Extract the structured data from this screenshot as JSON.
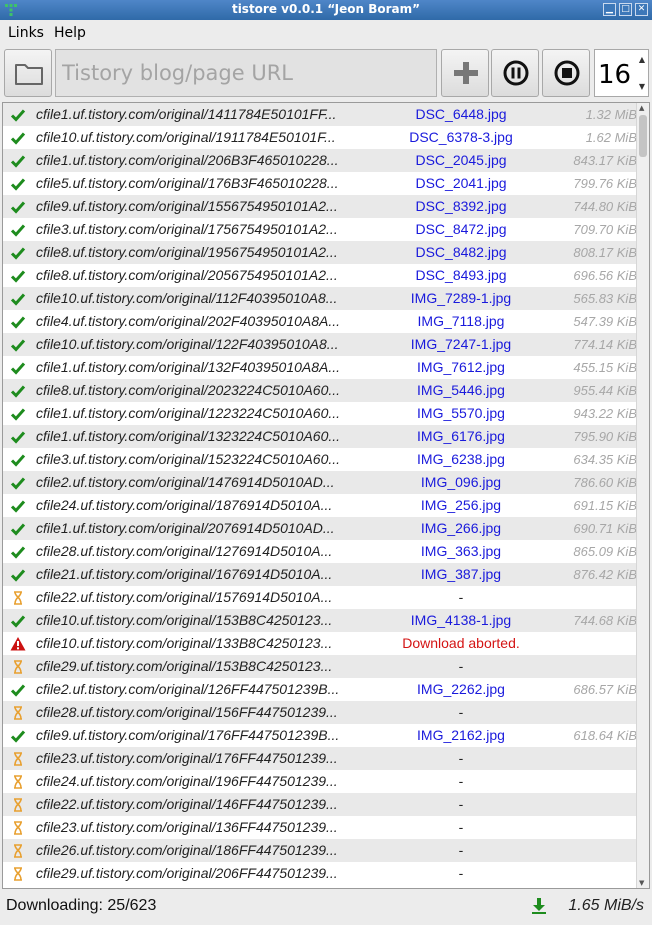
{
  "window": {
    "title": "tistore v0.0.1 “Jeon Boram”"
  },
  "menu": {
    "links": "Links",
    "help": "Help"
  },
  "toolbar": {
    "url_placeholder": "Tistory blog/page URL",
    "url_value": "",
    "threads": "16"
  },
  "icons": {
    "open": "folder-icon",
    "add": "plus-icon",
    "pause": "pause-icon",
    "stop": "stop-icon",
    "download": "download-arrow-icon"
  },
  "colors": {
    "done": "#1e8c1e",
    "pending": "#e8a030",
    "error": "#cc1111",
    "filename": "#1a1adc",
    "error_text": "#d41414"
  },
  "rows": [
    {
      "status": "done",
      "url": "cfile1.uf.tistory.com/original/1411784E50101FF...",
      "file": "DSC_6448.jpg",
      "size": "1.32 MiB"
    },
    {
      "status": "done",
      "url": "cfile10.uf.tistory.com/original/1911784E50101F...",
      "file": "DSC_6378-3.jpg",
      "size": "1.62 MiB"
    },
    {
      "status": "done",
      "url": "cfile1.uf.tistory.com/original/206B3F465010228...",
      "file": "DSC_2045.jpg",
      "size": "843.17 KiB"
    },
    {
      "status": "done",
      "url": "cfile5.uf.tistory.com/original/176B3F465010228...",
      "file": "DSC_2041.jpg",
      "size": "799.76 KiB"
    },
    {
      "status": "done",
      "url": "cfile9.uf.tistory.com/original/1556754950101A2...",
      "file": "DSC_8392.jpg",
      "size": "744.80 KiB"
    },
    {
      "status": "done",
      "url": "cfile3.uf.tistory.com/original/1756754950101A2...",
      "file": "DSC_8472.jpg",
      "size": "709.70 KiB"
    },
    {
      "status": "done",
      "url": "cfile8.uf.tistory.com/original/1956754950101A2...",
      "file": "DSC_8482.jpg",
      "size": "808.17 KiB"
    },
    {
      "status": "done",
      "url": "cfile8.uf.tistory.com/original/2056754950101A2...",
      "file": "DSC_8493.jpg",
      "size": "696.56 KiB"
    },
    {
      "status": "done",
      "url": "cfile10.uf.tistory.com/original/112F40395010A8...",
      "file": "IMG_7289-1.jpg",
      "size": "565.83 KiB"
    },
    {
      "status": "done",
      "url": "cfile4.uf.tistory.com/original/202F40395010A8A...",
      "file": "IMG_7118.jpg",
      "size": "547.39 KiB"
    },
    {
      "status": "done",
      "url": "cfile10.uf.tistory.com/original/122F40395010A8...",
      "file": "IMG_7247-1.jpg",
      "size": "774.14 KiB"
    },
    {
      "status": "done",
      "url": "cfile1.uf.tistory.com/original/132F40395010A8A...",
      "file": "IMG_7612.jpg",
      "size": "455.15 KiB"
    },
    {
      "status": "done",
      "url": "cfile8.uf.tistory.com/original/2023224C5010A60...",
      "file": "IMG_5446.jpg",
      "size": "955.44 KiB"
    },
    {
      "status": "done",
      "url": "cfile1.uf.tistory.com/original/1223224C5010A60...",
      "file": "IMG_5570.jpg",
      "size": "943.22 KiB"
    },
    {
      "status": "done",
      "url": "cfile1.uf.tistory.com/original/1323224C5010A60...",
      "file": "IMG_6176.jpg",
      "size": "795.90 KiB"
    },
    {
      "status": "done",
      "url": "cfile3.uf.tistory.com/original/1523224C5010A60...",
      "file": "IMG_6238.jpg",
      "size": "634.35 KiB"
    },
    {
      "status": "done",
      "url": "cfile2.uf.tistory.com/original/1476914D5010AD...",
      "file": "IMG_096.jpg",
      "size": "786.60 KiB"
    },
    {
      "status": "done",
      "url": "cfile24.uf.tistory.com/original/1876914D5010A...",
      "file": "IMG_256.jpg",
      "size": "691.15 KiB"
    },
    {
      "status": "done",
      "url": "cfile1.uf.tistory.com/original/2076914D5010AD...",
      "file": "IMG_266.jpg",
      "size": "690.71 KiB"
    },
    {
      "status": "done",
      "url": "cfile28.uf.tistory.com/original/1276914D5010A...",
      "file": "IMG_363.jpg",
      "size": "865.09 KiB"
    },
    {
      "status": "done",
      "url": "cfile21.uf.tistory.com/original/1676914D5010A...",
      "file": "IMG_387.jpg",
      "size": "876.42 KiB"
    },
    {
      "status": "pending",
      "url": "cfile22.uf.tistory.com/original/1576914D5010A...",
      "file": "-",
      "size": ""
    },
    {
      "status": "done",
      "url": "cfile10.uf.tistory.com/original/153B8C4250123...",
      "file": "IMG_4138-1.jpg",
      "size": "744.68 KiB"
    },
    {
      "status": "error",
      "url": "cfile10.uf.tistory.com/original/133B8C4250123...",
      "file": "Download aborted.",
      "size": ""
    },
    {
      "status": "pending",
      "url": "cfile29.uf.tistory.com/original/153B8C4250123...",
      "file": "-",
      "size": ""
    },
    {
      "status": "done",
      "url": "cfile2.uf.tistory.com/original/126FF447501239B...",
      "file": "IMG_2262.jpg",
      "size": "686.57 KiB"
    },
    {
      "status": "pending",
      "url": "cfile28.uf.tistory.com/original/156FF447501239...",
      "file": "-",
      "size": ""
    },
    {
      "status": "done",
      "url": "cfile9.uf.tistory.com/original/176FF447501239B...",
      "file": "IMG_2162.jpg",
      "size": "618.64 KiB"
    },
    {
      "status": "pending",
      "url": "cfile23.uf.tistory.com/original/176FF447501239...",
      "file": "-",
      "size": ""
    },
    {
      "status": "pending",
      "url": "cfile24.uf.tistory.com/original/196FF447501239...",
      "file": "-",
      "size": ""
    },
    {
      "status": "pending",
      "url": "cfile22.uf.tistory.com/original/146FF447501239...",
      "file": "-",
      "size": ""
    },
    {
      "status": "pending",
      "url": "cfile23.uf.tistory.com/original/136FF447501239...",
      "file": "-",
      "size": ""
    },
    {
      "status": "pending",
      "url": "cfile26.uf.tistory.com/original/186FF447501239...",
      "file": "-",
      "size": ""
    },
    {
      "status": "pending",
      "url": "cfile29.uf.tistory.com/original/206FF447501239...",
      "file": "-",
      "size": ""
    }
  ],
  "status": {
    "text": "Downloading: 25/623",
    "speed": "1.65 MiB/s"
  }
}
